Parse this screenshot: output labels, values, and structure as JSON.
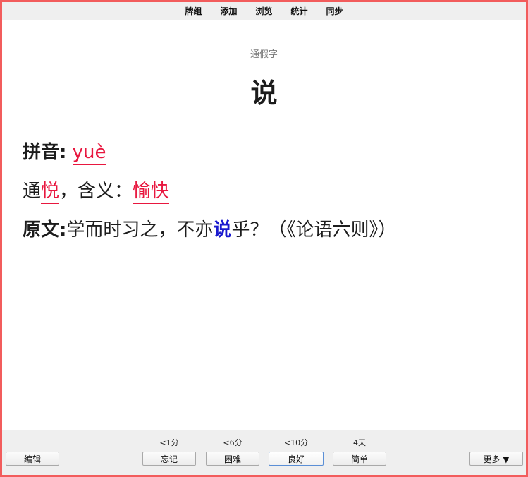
{
  "menu": {
    "items": [
      "牌组",
      "添加",
      "浏览",
      "统计",
      "同步"
    ]
  },
  "card": {
    "type_label": "通假字",
    "headword": "说",
    "pinyin_label": "拼音:",
    "pinyin_value": "yuè",
    "tong_prefix": "通",
    "tong_char": "悦",
    "meaning_sep": "，含义：",
    "meaning_value": "愉快",
    "source_label": "原文:",
    "source_before": "学而时习之，不亦",
    "source_highlight": "说",
    "source_after": "乎？（《论语六则》）"
  },
  "footer": {
    "edit_label": "编辑",
    "more_label": "更多 ▼",
    "answers": [
      {
        "interval": "<1分",
        "label": "忘记"
      },
      {
        "interval": "<6分",
        "label": "困难"
      },
      {
        "interval": "<10分",
        "label": "良好"
      },
      {
        "interval": "4天",
        "label": "简单"
      }
    ]
  },
  "colors": {
    "frame_border": "#f25c5c",
    "answer_red": "#e8173f",
    "highlight_blue": "#1a1acf"
  }
}
